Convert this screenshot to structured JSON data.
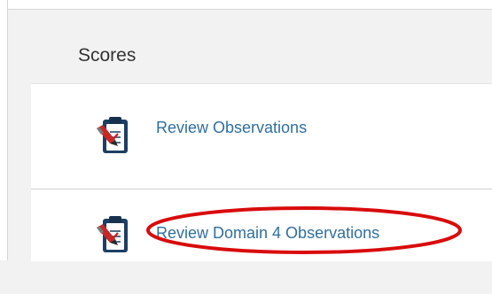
{
  "scores": {
    "title": "Scores",
    "items": [
      {
        "label": "Review Observations",
        "icon": "clipboard-check-icon"
      },
      {
        "label": "Review Domain 4 Observations",
        "icon": "clipboard-check-icon",
        "highlighted": true
      }
    ]
  },
  "colors": {
    "link": "#2f6f9f",
    "annotation": "#d90b0b",
    "background": "#f2f2f2",
    "panel": "#ffffff"
  }
}
